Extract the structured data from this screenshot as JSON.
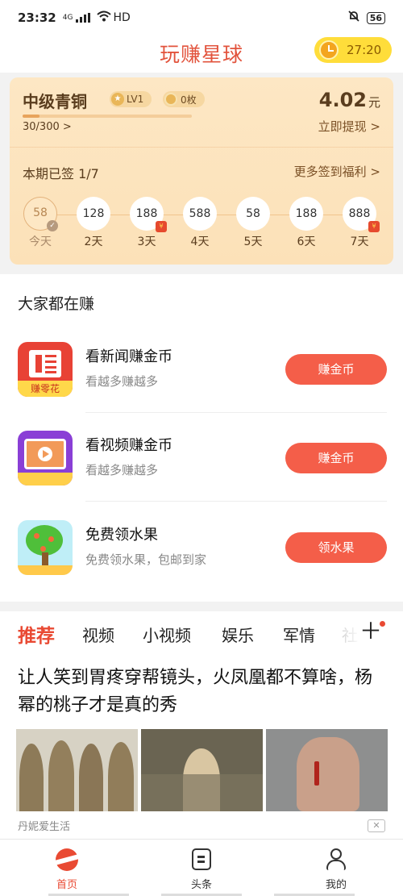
{
  "status_bar": {
    "time": "23:32",
    "network": "4G",
    "wifi_label": "HD",
    "battery": "56",
    "icons": [
      "signal-icon",
      "wifi-icon",
      "mute-icon",
      "battery-icon"
    ]
  },
  "header": {
    "app_title": "玩赚星球",
    "timer": "27:20"
  },
  "signin_card": {
    "level_name": "中级青铜",
    "level_badge": "LV1",
    "coin_badge": "0枚",
    "progress_text": "30/300 >",
    "progress_fraction": 0.1,
    "balance": "4.02",
    "balance_unit": "元",
    "withdraw_label": "立即提现 >",
    "signed_text": "本期已签 1/7",
    "more_label": "更多签到福利 >",
    "days": [
      {
        "value": "58",
        "label": "今天",
        "done": true
      },
      {
        "value": "128",
        "label": "2天"
      },
      {
        "value": "188",
        "label": "3天",
        "gift": true
      },
      {
        "value": "588",
        "label": "4天"
      },
      {
        "value": "58",
        "label": "5天"
      },
      {
        "value": "188",
        "label": "6天"
      },
      {
        "value": "888",
        "label": "7天",
        "gift": true
      }
    ]
  },
  "earners": {
    "title": "大家都在赚",
    "tasks": [
      {
        "name": "看新闻赚金币",
        "desc": "看越多赚越多",
        "button": "赚金币",
        "icon_tag": "赚零花"
      },
      {
        "name": "看视频赚金币",
        "desc": "看越多赚越多",
        "button": "赚金币"
      },
      {
        "name": "免费领水果",
        "desc": "免费领水果，包邮到家",
        "button": "领水果"
      }
    ]
  },
  "feed": {
    "tabs": [
      "推荐",
      "视频",
      "小视频",
      "娱乐",
      "军情",
      "社"
    ],
    "active_tab": 0,
    "headline": "让人笑到胃疼穿帮镜头，火凤凰都不算啥，杨幂的桃子才是真的秀",
    "source": "丹妮爱生活",
    "close_label": "✕"
  },
  "bottom_nav": {
    "items": [
      {
        "label": "首页",
        "icon": "planet-icon",
        "active": true
      },
      {
        "label": "头条",
        "icon": "headline-icon"
      },
      {
        "label": "我的",
        "icon": "profile-icon"
      }
    ]
  },
  "colors": {
    "accent": "#e94a33",
    "button": "#f45e49",
    "card_bg": "#fde7c4",
    "timer_bg": "#ffdd3a"
  }
}
